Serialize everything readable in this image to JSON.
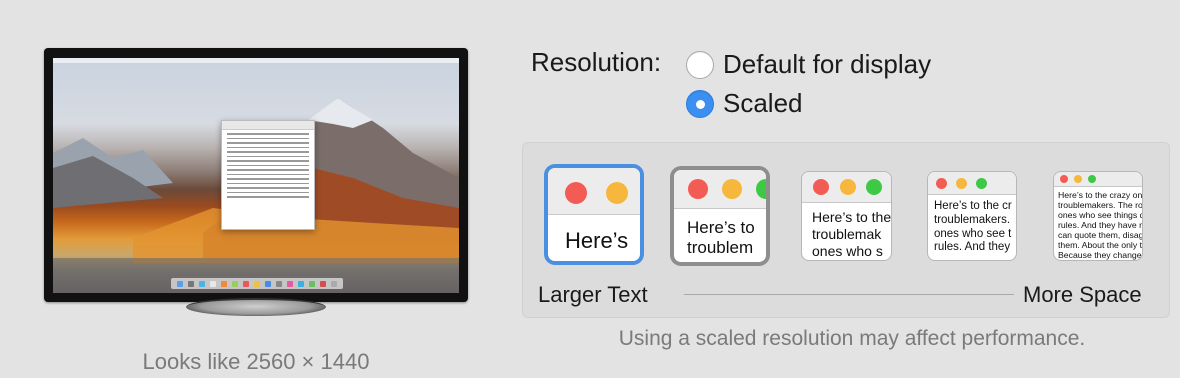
{
  "preview": {
    "looks_like": "Looks like 2560 × 1440"
  },
  "resolution": {
    "label": "Resolution:",
    "options": [
      {
        "label": "Default for display",
        "selected": false
      },
      {
        "label": "Scaled",
        "selected": true
      }
    ]
  },
  "scaled": {
    "options": [
      {
        "sample_text": "Here’s",
        "selected": true
      },
      {
        "sample_text": "Here’s to\ntroublem",
        "selected": false
      },
      {
        "sample_text": "Here’s to the\ntroublemak\nones who s",
        "selected": false
      },
      {
        "sample_text": "Here’s to the cr\ntroublemakers.\nones who see t\nrules. And they",
        "selected": false
      },
      {
        "sample_text": "Here’s to the crazy one\ntroublemakers. The rou\nones who see things dif\nrules. And they have no\ncan quote them, disagre\nthem. About the only th\nBecause they change t",
        "selected": false
      }
    ],
    "left_label": "Larger Text",
    "right_label": "More Space",
    "note": "Using a scaled resolution may affect performance."
  },
  "colors": {
    "accent": "#3a8ff0",
    "traffic_red": "#f25c54",
    "traffic_yellow": "#f6b73c",
    "traffic_green": "#3ec945"
  }
}
